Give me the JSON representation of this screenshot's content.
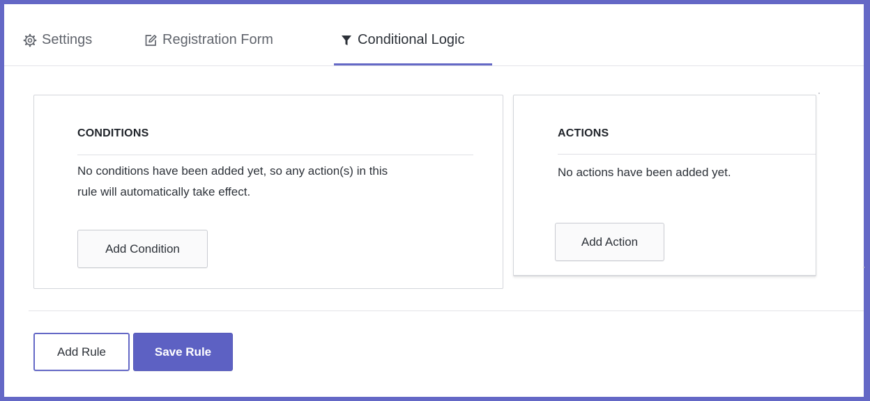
{
  "tabs": [
    {
      "label": "Settings",
      "icon": "gear-icon",
      "active": false
    },
    {
      "label": "Registration Form",
      "icon": "edit-icon",
      "active": false
    },
    {
      "label": "Conditional Logic",
      "icon": "filter-icon",
      "active": true
    }
  ],
  "conditions": {
    "title": "CONDITIONS",
    "line1": "No conditions have been added yet, so any action(s) in this",
    "line2": "rule will automatically take effect.",
    "button_label": "Add Condition"
  },
  "actions": {
    "title": "ACTIONS",
    "text": "No actions have been added yet.",
    "button_label": "Add Action"
  },
  "footer": {
    "add_rule_label": "Add Rule",
    "save_rule_label": "Save Rule"
  },
  "colors": {
    "accent": "#6468c6",
    "save_button": "#5d61c3",
    "text": "#2c3138",
    "muted_text": "#60646c"
  }
}
